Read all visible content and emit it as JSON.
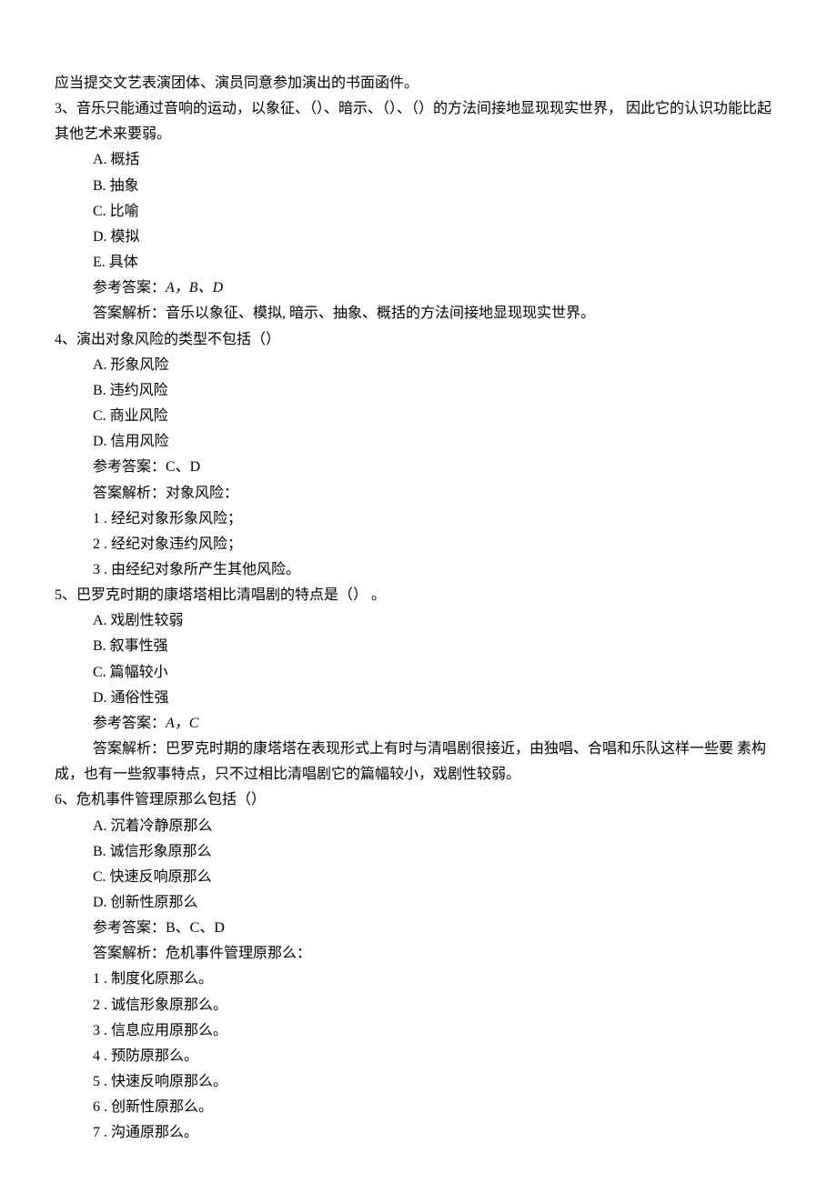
{
  "preface": "应当提交文艺表演团体、演员同意参加演出的书面函件。",
  "q3": {
    "stem": "3、音乐只能通过音响的运动，以象征、（）、暗示、（）、（）的方法间接地显现现实世界， 因此它的认识功能比起其他艺术来要弱。",
    "A": "A. 概括",
    "B": "B. 抽象",
    "C": "C. 比喻",
    "D": "D. 模拟",
    "E": "E. 具体",
    "ans_label": "参考答案：",
    "ans_val": "A，B、D",
    "expl": "答案解析：音乐以象征、模拟,  暗示、抽象、概括的方法间接地显现现实世界。"
  },
  "q4": {
    "stem": "4、演出对象风险的类型不包括（）",
    "A": "A. 形象风险",
    "B": "B. 违约风险",
    "C": "C. 商业风险",
    "D": "D. 信用风险",
    "ans": "参考答案：C、D",
    "expl": "答案解析：对象风险：",
    "i1": "1  . 经纪对象形象风险；",
    "i2": "2  . 经纪对象违约风险；",
    "i3": "3  . 由经纪对象所产生其他风险。"
  },
  "q5": {
    "stem": "5、巴罗克时期的康塔塔相比清唱剧的特点是（） 。",
    "A": "A. 戏剧性较弱",
    "B": "B. 叙事性强",
    "C": "C. 篇幅较小",
    "D": "D. 通俗性强",
    "ans_label": "参考答案：",
    "ans_val": "A，C",
    "expl": "答案解析：巴罗克时期的康塔塔在表现形式上有时与清唱剧很接近，由独唱、合唱和乐队这样一些要  素构成，也有一些叙事特点，只不过相比清唱剧它的篇幅较小，戏剧性较弱。"
  },
  "q6": {
    "stem": "6、危机事件管理原那么包括（）",
    "A": "A. 沉着冷静原那么",
    "B": "B. 诚信形象原那么",
    "C": "C. 快速反响原那么",
    "D": "D. 创新性原那么",
    "ans": "参考答案：B、C、D",
    "expl": "答案解析：危机事件管理原那么：",
    "i1": "1  . 制度化原那么。",
    "i2": "2  . 诚信形象原那么。",
    "i3": "3  . 信息应用原那么。",
    "i4": "4  . 预防原那么。",
    "i5": "5  . 快速反响原那么。",
    "i6": "6  . 创新性原那么。",
    "i7": "7  . 沟通原那么。"
  }
}
